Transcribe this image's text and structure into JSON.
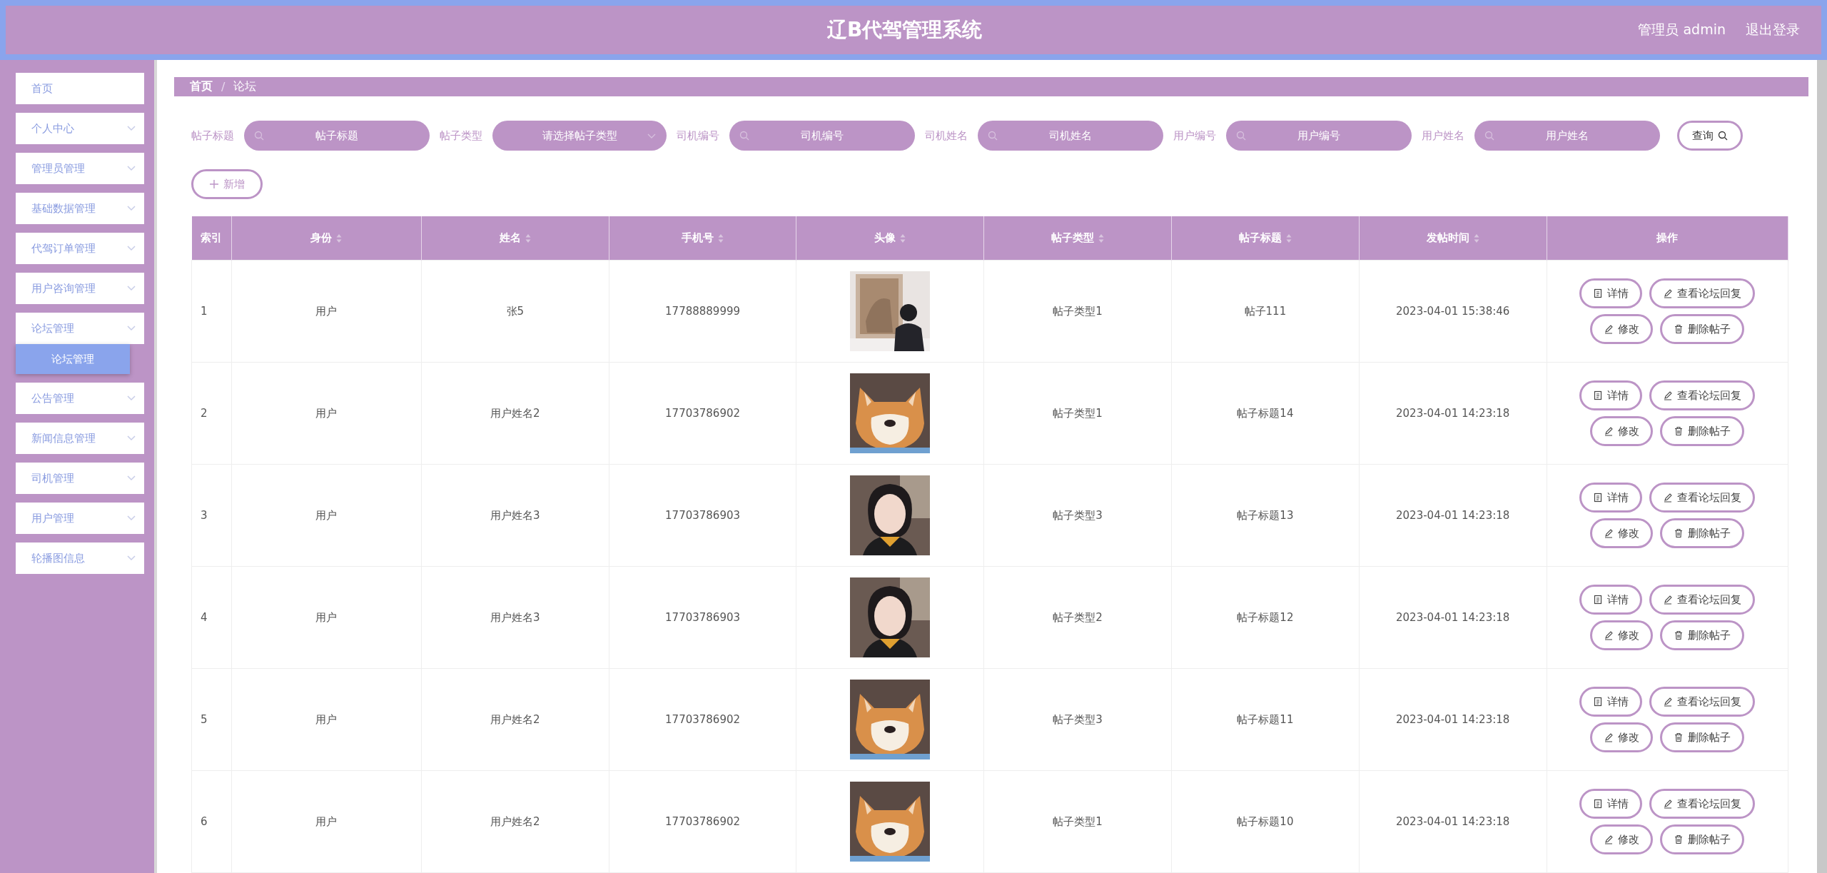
{
  "header": {
    "title": "辽B代驾管理系统",
    "user": "管理员 admin",
    "logout": "退出登录"
  },
  "sidebar": {
    "items": [
      {
        "label": "首页",
        "kind": "link"
      },
      {
        "label": "个人中心",
        "kind": "menu"
      },
      {
        "label": "管理员管理",
        "kind": "menu"
      },
      {
        "label": "基础数据管理",
        "kind": "menu"
      },
      {
        "label": "代驾订单管理",
        "kind": "menu"
      },
      {
        "label": "用户咨询管理",
        "kind": "menu"
      },
      {
        "label": "论坛管理",
        "kind": "menu",
        "children": [
          {
            "label": "论坛管理",
            "selected": true
          }
        ]
      },
      {
        "label": "公告管理",
        "kind": "menu"
      },
      {
        "label": "新闻信息管理",
        "kind": "menu"
      },
      {
        "label": "司机管理",
        "kind": "menu"
      },
      {
        "label": "用户管理",
        "kind": "menu"
      },
      {
        "label": "轮播图信息",
        "kind": "menu"
      }
    ]
  },
  "breadcrumb": {
    "items": [
      "首页",
      "论坛"
    ],
    "separator": "/"
  },
  "filters": [
    {
      "label": "帖子标题",
      "placeholder": "帖子标题",
      "kind": "text"
    },
    {
      "label": "帖子类型",
      "placeholder": "请选择帖子类型",
      "kind": "select"
    },
    {
      "label": "司机编号",
      "placeholder": "司机编号",
      "kind": "text"
    },
    {
      "label": "司机姓名",
      "placeholder": "司机姓名",
      "kind": "text"
    },
    {
      "label": "用户编号",
      "placeholder": "用户编号",
      "kind": "text"
    },
    {
      "label": "用户姓名",
      "placeholder": "用户姓名",
      "kind": "text"
    }
  ],
  "search_button": "查询",
  "add_button": "新增",
  "table": {
    "columns": [
      {
        "label": "索引",
        "sortable": false
      },
      {
        "label": "身份",
        "sortable": true
      },
      {
        "label": "姓名",
        "sortable": true
      },
      {
        "label": "手机号",
        "sortable": true
      },
      {
        "label": "头像",
        "sortable": true
      },
      {
        "label": "帖子类型",
        "sortable": true
      },
      {
        "label": "帖子标题",
        "sortable": true
      },
      {
        "label": "发帖时间",
        "sortable": true
      },
      {
        "label": "操作",
        "sortable": false
      }
    ],
    "rows": [
      {
        "index": "1",
        "role": "用户",
        "name": "张5",
        "phone": "17788889999",
        "type": "帖子类型1",
        "title": "帖子111",
        "time": "2023-04-01 15:38:46",
        "actions": [
          "详情",
          "查看论坛回复",
          "修改",
          "删除帖子"
        ]
      },
      {
        "index": "2",
        "role": "用户",
        "name": "用户姓名2",
        "phone": "17703786902",
        "type": "帖子类型1",
        "title": "帖子标题14",
        "time": "2023-04-01 14:23:18",
        "actions": [
          "详情",
          "查看论坛回复",
          "修改",
          "删除帖子"
        ]
      },
      {
        "index": "3",
        "role": "用户",
        "name": "用户姓名3",
        "phone": "17703786903",
        "type": "帖子类型3",
        "title": "帖子标题13",
        "time": "2023-04-01 14:23:18",
        "actions": [
          "详情",
          "查看论坛回复",
          "修改",
          "删除帖子"
        ]
      },
      {
        "index": "4",
        "role": "用户",
        "name": "用户姓名3",
        "phone": "17703786903",
        "type": "帖子类型2",
        "title": "帖子标题12",
        "time": "2023-04-01 14:23:18",
        "actions": [
          "详情",
          "查看论坛回复",
          "修改",
          "删除帖子"
        ]
      },
      {
        "index": "5",
        "role": "用户",
        "name": "用户姓名2",
        "phone": "17703786902",
        "type": "帖子类型3",
        "title": "帖子标题11",
        "time": "2023-04-01 14:23:18",
        "actions": [
          "详情",
          "查看论坛回复",
          "修改",
          "删除帖子"
        ]
      },
      {
        "index": "6",
        "role": "用户",
        "name": "用户姓名2",
        "phone": "17703786902",
        "type": "帖子类型1",
        "title": "帖子标题10",
        "time": "2023-04-01 14:23:18",
        "actions": [
          "详情",
          "查看论坛回复",
          "修改",
          "删除帖子"
        ]
      }
    ]
  }
}
